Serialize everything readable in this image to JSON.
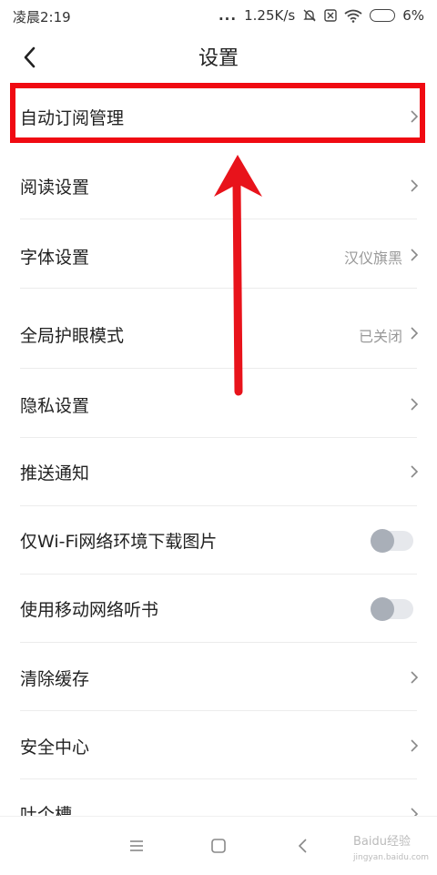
{
  "status_bar": {
    "time": "凌晨2:19",
    "dots": "...",
    "network_speed": "1.25K/s",
    "battery": "6%",
    "icons": [
      "mute-bell-icon",
      "sim-off-icon",
      "wifi-icon",
      "battery-icon"
    ]
  },
  "header": {
    "title": "设置",
    "back_icon": "chevron-left-icon"
  },
  "settings": [
    {
      "label": "自动订阅管理",
      "type": "link"
    },
    {
      "label": "阅读设置",
      "type": "link"
    },
    {
      "label": "字体设置",
      "type": "link",
      "value": "汉仪旗黑"
    },
    {
      "label": "全局护眼模式",
      "type": "link",
      "value": "已关闭"
    },
    {
      "label": "隐私设置",
      "type": "link"
    },
    {
      "label": "推送通知",
      "type": "link"
    },
    {
      "label": "仅Wi-Fi网络环境下载图片",
      "type": "toggle",
      "on": false
    },
    {
      "label": "使用移动网络听书",
      "type": "toggle",
      "on": false
    },
    {
      "label": "清除缓存",
      "type": "link"
    },
    {
      "label": "安全中心",
      "type": "link"
    },
    {
      "label": "吐个槽",
      "type": "link"
    }
  ],
  "annotation": {
    "highlight_color": "#f00a12",
    "arrow_color": "#e8131b"
  },
  "nav_bar": {
    "icons": [
      "menu-icon",
      "home-square-icon",
      "back-triangle-icon"
    ]
  },
  "watermark": {
    "brand": "Baidu经验",
    "url": "jingyan.baidu.com"
  }
}
